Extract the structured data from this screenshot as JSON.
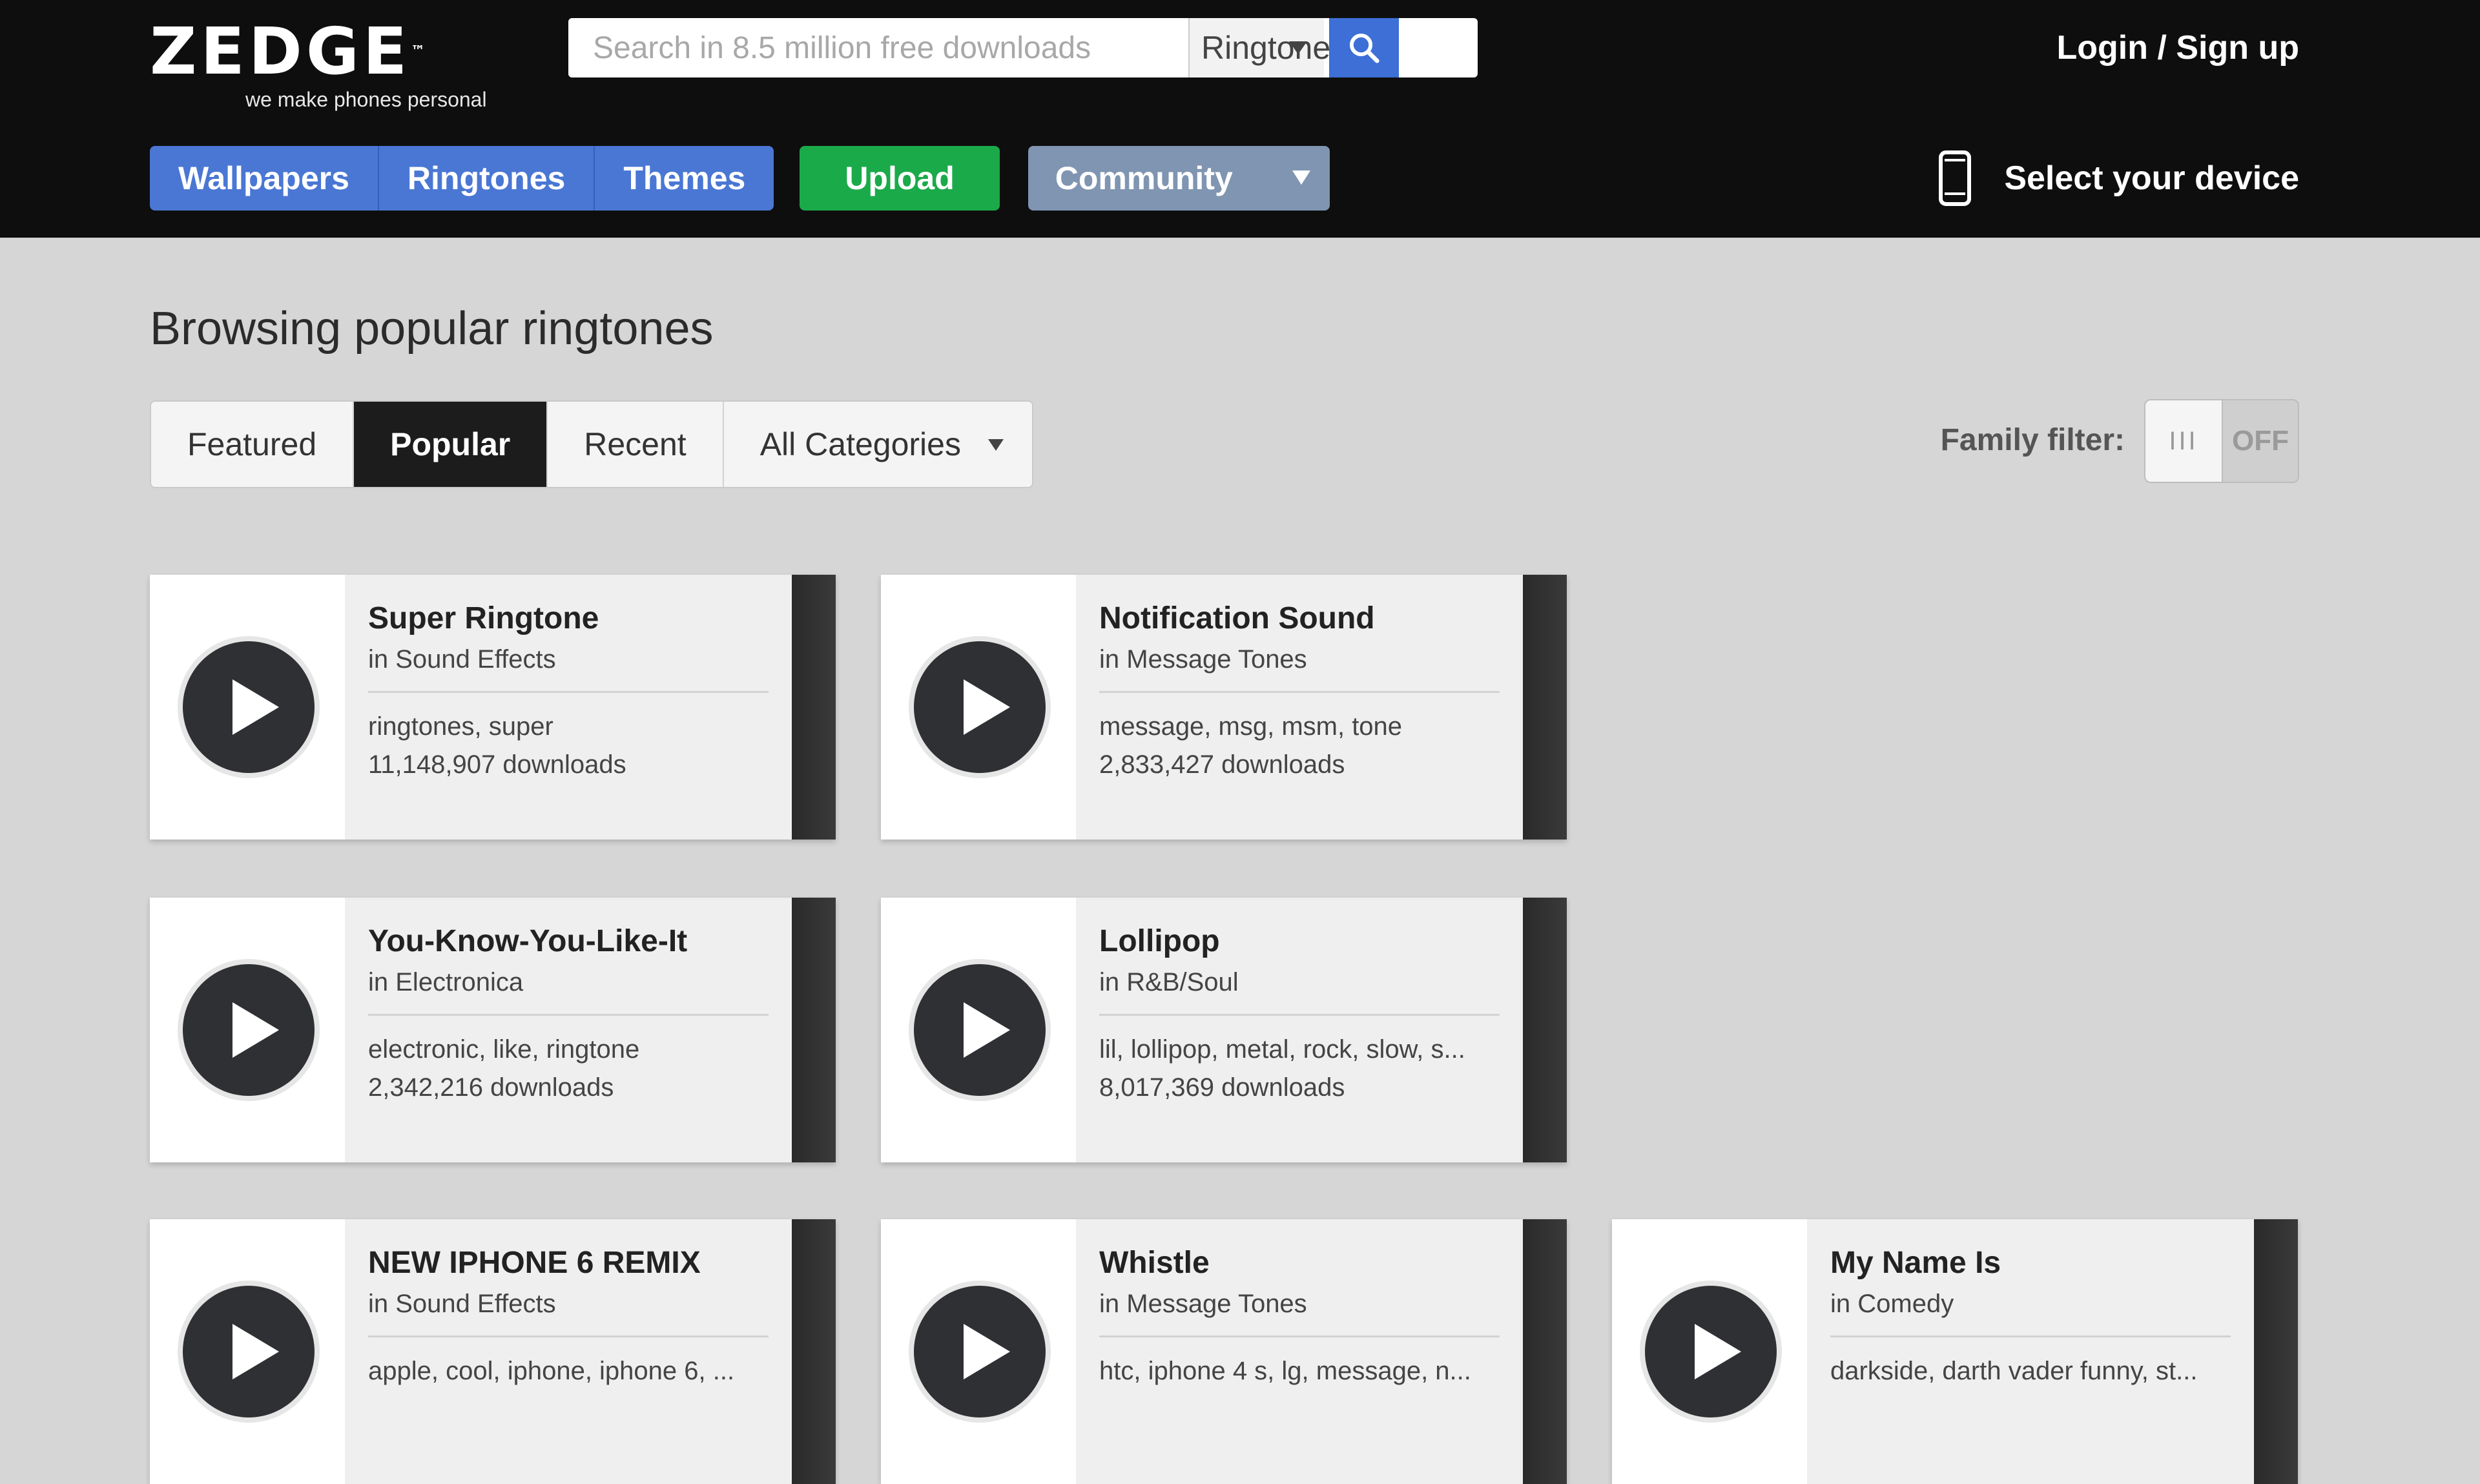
{
  "header": {
    "logo": "ZEDGE",
    "logo_tm": "™",
    "tagline": "we make phones personal",
    "search": {
      "placeholder": "Search in 8.5 million free downloads",
      "scope": "Ringtones"
    },
    "login": "Login / Sign up",
    "nav": {
      "wallpapers": "Wallpapers",
      "ringtones": "Ringtones",
      "themes": "Themes",
      "upload": "Upload",
      "community": "Community"
    },
    "device": "Select your device"
  },
  "main": {
    "title": "Browsing popular ringtones",
    "tabs": {
      "featured": "Featured",
      "popular": "Popular",
      "recent": "Recent",
      "categories": "All Categories"
    },
    "family_filter": {
      "label": "Family filter:",
      "knob": "III",
      "state": "OFF"
    },
    "ringtones": [
      {
        "title": "Super Ringtone",
        "category": "in Sound Effects",
        "tags": "ringtones, super",
        "downloads": "11,148,907 downloads"
      },
      {
        "title": "Notification Sound",
        "category": "in Message Tones",
        "tags": "message, msg, msm, tone",
        "downloads": "2,833,427 downloads"
      },
      {
        "title": "You-Know-You-Like-It",
        "category": "in Electronica",
        "tags": "electronic, like, ringtone",
        "downloads": "2,342,216 downloads"
      },
      {
        "title": "Lollipop",
        "category": "in R&B/Soul",
        "tags": "lil, lollipop, metal, rock, slow, s...",
        "downloads": "8,017,369 downloads"
      },
      {
        "title": "NEW IPHONE 6 REMIX",
        "category": "in Sound Effects",
        "tags": "apple, cool, iphone, iphone 6, ...",
        "downloads": ""
      },
      {
        "title": "Whistle",
        "category": "in Message Tones",
        "tags": "htc, iphone 4 s, lg, message, n...",
        "downloads": ""
      },
      {
        "title": "My Name Is",
        "category": "in Comedy",
        "tags": "darkside, darth vader funny, st...",
        "downloads": ""
      }
    ]
  },
  "colors": {
    "header_bg": "#0e0e0e",
    "nav_blue": "#4a77d4",
    "upload_green": "#1aaa4a",
    "community_gray": "#7f95b1",
    "page_bg": "#d6d6d6"
  }
}
